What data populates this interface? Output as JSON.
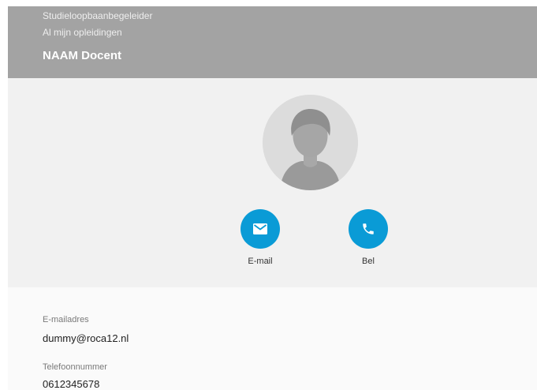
{
  "header": {
    "role": "Studieloopbaanbegeleider",
    "all_programs": "Al mijn opleidingen",
    "teacher_name": "NAAM Docent"
  },
  "actions": {
    "email_label": "E-mail",
    "call_label": "Bel"
  },
  "details": {
    "email_label": "E-mailadres",
    "email_value": "dummy@roca12.nl",
    "phone_label": "Telefoonnummer",
    "phone_value": "0612345678"
  },
  "colors": {
    "header_bg": "#a3a3a3",
    "profile_bg": "#f1f1f1",
    "accent": "#0a9bd6"
  },
  "icons": {
    "avatar": "person-silhouette-icon",
    "email": "envelope-icon",
    "call": "phone-icon"
  }
}
